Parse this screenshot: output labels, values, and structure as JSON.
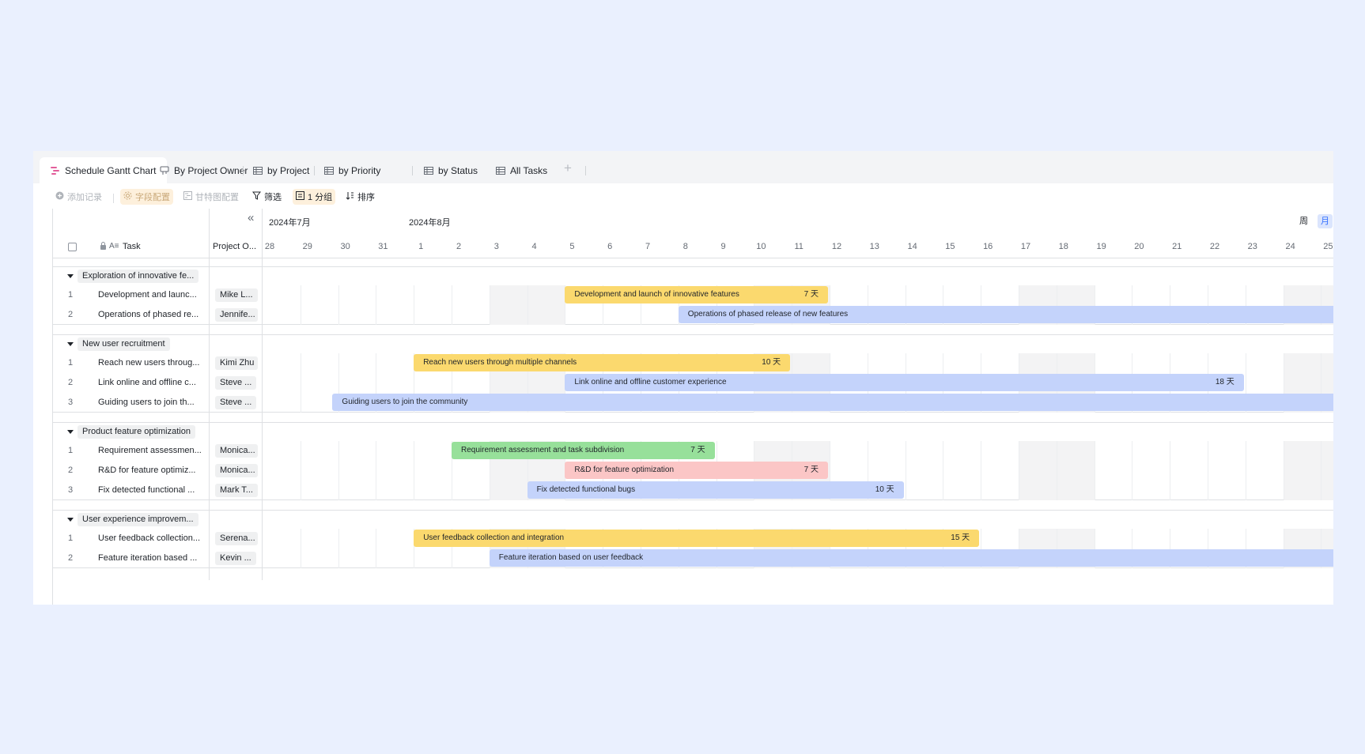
{
  "tabs": [
    {
      "label": "Schedule Gantt Chart",
      "icon": "gantt-icon",
      "active": true
    },
    {
      "label": "By Project Owner",
      "icon": "board-icon"
    },
    {
      "label": "by Project",
      "icon": "grid-icon"
    },
    {
      "label": "by Priority",
      "icon": "grid-icon"
    },
    {
      "label": "by Status",
      "icon": "grid-icon"
    },
    {
      "label": "All Tasks",
      "icon": "grid-icon"
    }
  ],
  "toolbar": {
    "add_record": "添加记录",
    "field_config": "字段配置",
    "gantt_config": "甘特图配置",
    "filter": "筛选",
    "group": "1 分组",
    "sort": "排序"
  },
  "columns": {
    "task": "Task",
    "owner": "Project O..."
  },
  "timeline": {
    "months": [
      "2024年7月",
      "2024年8月"
    ],
    "days": [
      "28",
      "29",
      "30",
      "31",
      "1",
      "2",
      "3",
      "4",
      "5",
      "6",
      "7",
      "8",
      "9",
      "10",
      "11",
      "12",
      "13",
      "14",
      "15",
      "16",
      "17",
      "18",
      "19",
      "20",
      "21",
      "22",
      "23",
      "24",
      "25"
    ],
    "view_week": "周",
    "view_month": "月"
  },
  "groups": [
    {
      "name": "Exploration of innovative fe...",
      "rows": [
        {
          "num": "1",
          "task": "Development and launc...",
          "owner": "Mike L...",
          "bar": "Development and launch of innovative features",
          "duration": "7 天",
          "color": "yellow",
          "start": 8,
          "days": 7
        },
        {
          "num": "2",
          "task": "Operations of phased re...",
          "owner": "Jennife...",
          "bar": "Operations of phased release of new features",
          "duration": "",
          "color": "blue",
          "start": 11,
          "days": 20
        }
      ]
    },
    {
      "name": "New user recruitment",
      "rows": [
        {
          "num": "1",
          "task": "Reach new users throug...",
          "owner": "Kimi Zhu",
          "bar": "Reach new users through multiple channels",
          "duration": "10 天",
          "color": "yellow",
          "start": 4,
          "days": 10
        },
        {
          "num": "2",
          "task": "Link online and offline c...",
          "owner": "Steve ...",
          "bar": "Link online and offline customer experience",
          "duration": "18 天",
          "color": "blue",
          "start": 8,
          "days": 18
        },
        {
          "num": "3",
          "task": "Guiding users to join th...",
          "owner": "Steve ...",
          "bar": "Guiding users to join the community",
          "duration": "",
          "color": "blue",
          "start": 1.85,
          "days": 30
        }
      ]
    },
    {
      "name": "Product feature optimization",
      "rows": [
        {
          "num": "1",
          "task": "Requirement assessmen...",
          "owner": "Monica...",
          "bar": "Requirement assessment and task subdivision",
          "duration": "7 天",
          "color": "green",
          "start": 5,
          "days": 7
        },
        {
          "num": "2",
          "task": "R&D for feature optimiz...",
          "owner": "Monica...",
          "bar": "R&D for feature optimization",
          "duration": "7 天",
          "color": "pink",
          "start": 8,
          "days": 7
        },
        {
          "num": "3",
          "task": "Fix detected functional ...",
          "owner": "Mark T...",
          "bar": "Fix detected functional bugs",
          "duration": "10 天",
          "color": "blue",
          "start": 7,
          "days": 10
        }
      ]
    },
    {
      "name": "User experience improvem...",
      "rows": [
        {
          "num": "1",
          "task": "User feedback collection...",
          "owner": "Serena...",
          "bar": "User feedback collection and integration",
          "duration": "15 天",
          "color": "yellow",
          "start": 4,
          "days": 15
        },
        {
          "num": "2",
          "task": "Feature iteration based ...",
          "owner": "Kevin ...",
          "bar": "Feature iteration based on user feedback",
          "duration": "",
          "color": "blue",
          "start": 6,
          "days": 25
        }
      ]
    }
  ],
  "colors": {
    "yellow": "#fbd96e",
    "blue": "#c4d3fb",
    "green": "#97e09a",
    "pink": "#fbc6c6",
    "accent": "#3370ff"
  }
}
